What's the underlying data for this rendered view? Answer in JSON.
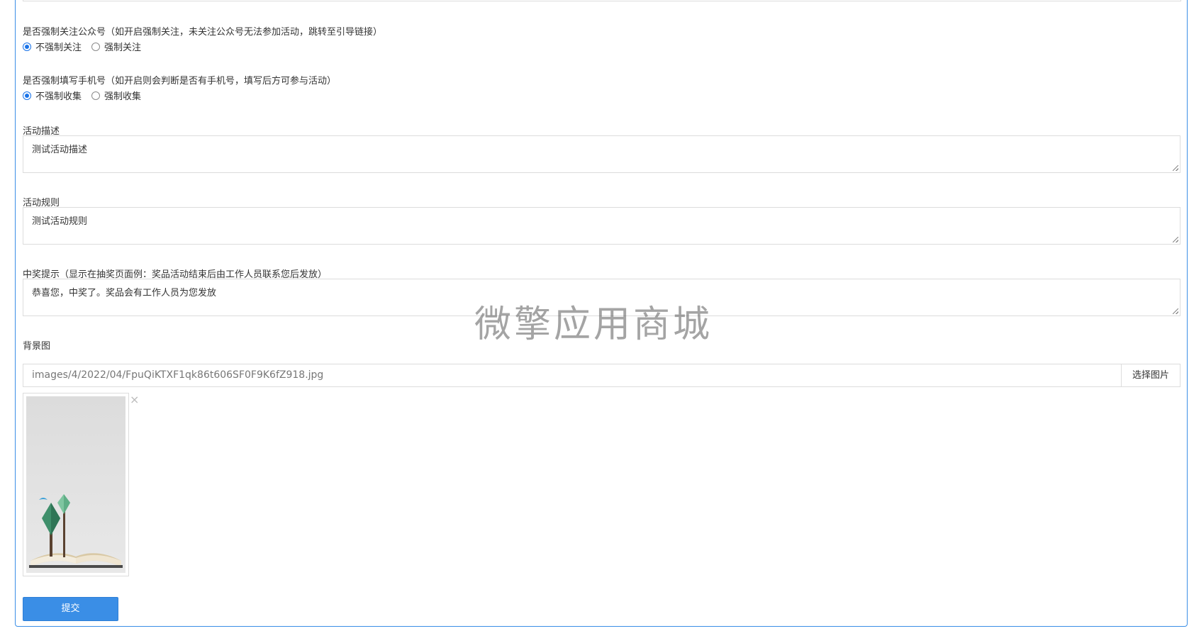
{
  "form": {
    "follow": {
      "label": "是否强制关注公众号（如开启强制关注，未关注公众号无法参加活动，跳转至引导链接）",
      "options": [
        {
          "label": "不强制关注",
          "checked": true
        },
        {
          "label": "强制关注",
          "checked": false
        }
      ]
    },
    "phone": {
      "label": "是否强制填写手机号（如开启则会判断是否有手机号，填写后方可参与活动）",
      "options": [
        {
          "label": "不强制收集",
          "checked": true
        },
        {
          "label": "强制收集",
          "checked": false
        }
      ]
    },
    "description": {
      "label": "活动描述",
      "value": "测试活动描述"
    },
    "rules": {
      "label": "活动规则",
      "value": "测试活动规则"
    },
    "prize_tip": {
      "label": "中奖提示（显示在抽奖页面例：奖品活动结束后由工作人员联系您后发放）",
      "value": "恭喜您，中奖了。奖品会有工作人员为您发放"
    },
    "background": {
      "label": "背景图",
      "value": "images/4/2022/04/FpuQiKTXF1qk86t606SF0F9K6fZ918.jpg",
      "button": "选择图片",
      "remove": "×"
    },
    "submit": "提交"
  },
  "watermark": "微擎应用商城"
}
